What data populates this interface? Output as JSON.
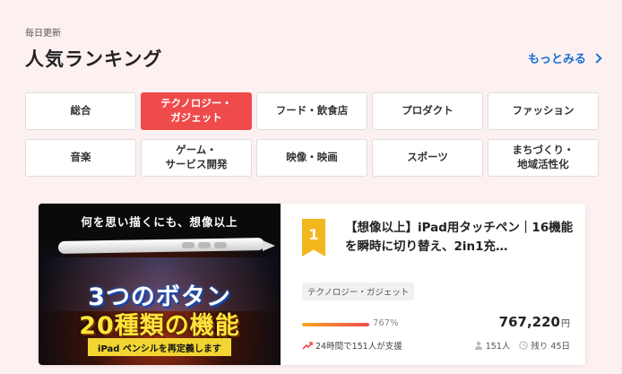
{
  "header": {
    "subtitle": "毎日更新",
    "title": "人気ランキング",
    "more_label": "もっとみる"
  },
  "categories": [
    {
      "label": "総合",
      "active": false
    },
    {
      "label": "テクノロジー・\nガジェット",
      "active": true
    },
    {
      "label": "フード・飲食店",
      "active": false
    },
    {
      "label": "プロダクト",
      "active": false
    },
    {
      "label": "ファッション",
      "active": false
    },
    {
      "label": "音楽",
      "active": false
    },
    {
      "label": "ゲーム・\nサービス開発",
      "active": false
    },
    {
      "label": "映像・映画",
      "active": false
    },
    {
      "label": "スポーツ",
      "active": false
    },
    {
      "label": "まちづくり・\n地域活性化",
      "active": false
    }
  ],
  "item": {
    "rank": "1",
    "title": "【想像以上】iPad用タッチペン｜16機能を瞬時に切り替え、2in1充…",
    "tag": "テクノロジー・ガジェット",
    "progress_percent": 767,
    "percent_label": "767%",
    "amount": "767,220",
    "currency": "円",
    "supporters_24h": "24時間で151人が支援",
    "backers": "151人",
    "remaining": "残り 45日",
    "thumbnail": {
      "top_text": "何を思い描くにも、想像以上",
      "headline1": "3つのボタン",
      "headline2": "20種類の機能",
      "banner": "iPad ペンシルを再定義します"
    }
  },
  "colors": {
    "accent": "#ef4b4b",
    "link": "#1a6fd6",
    "rank_badge": "#f2b71c",
    "background": "#fcf1f0"
  },
  "icons": [
    "chevron-right-icon",
    "trend-up-icon",
    "person-icon",
    "clock-icon"
  ]
}
